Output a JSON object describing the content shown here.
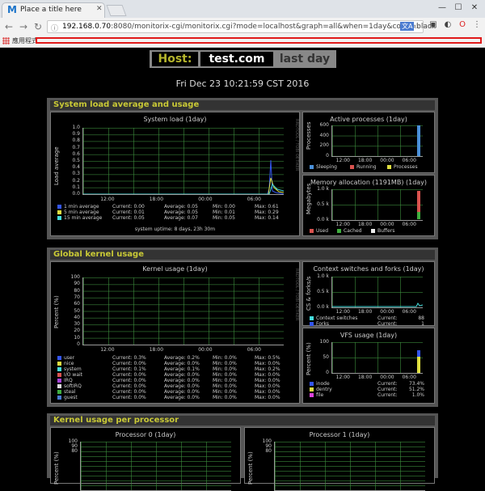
{
  "browser": {
    "tab_title": "Place a title here",
    "tab_favicon": "M",
    "url_prefix": "192.168.0.70",
    "url_rest": ":8080/monitorix-cgi/monitorix.cgi?mode=localhost&graph=all&when=1day&color=black",
    "translate_badge": "文A",
    "bookmarks_label": "應用程式",
    "window_controls": [
      "—",
      "☐",
      "✕"
    ]
  },
  "header": {
    "host_label": "Host:",
    "host_name": "test.com",
    "when_label": "last day",
    "date": "Fri Dec 23 10:21:59 CST 2016"
  },
  "colors": {
    "accent_title": "#c9c936",
    "sleeping": "#4a90d9",
    "running": "#d9534f",
    "processes": "#e0e040",
    "used": "#d9534f",
    "cached": "#3fae3f",
    "buffers": "#eeeeee"
  },
  "sections": {
    "system_load": {
      "title": "System load average and usage",
      "main": {
        "title": "System load  (1day)",
        "ylabel": "Load average",
        "side_label": "RRDTOOL / TOBI OETIKER",
        "yticks": [
          "1.0",
          "0.9",
          "0.8",
          "0.7",
          "0.6",
          "0.5",
          "0.4",
          "0.3",
          "0.2",
          "0.1",
          "0.0"
        ],
        "xticks": [
          "12:00",
          "18:00",
          "00:00",
          "06:00"
        ],
        "legend": [
          {
            "color": "#3355ee",
            "label": "1 min average",
            "current": "Current:  0.00",
            "average": "Average:  0.05",
            "min": "Min:   0.00",
            "max": "Max:  0.61"
          },
          {
            "color": "#e0e040",
            "label": "5 min average",
            "current": "Current:  0.01",
            "average": "Average:  0.05",
            "min": "Min:   0.01",
            "max": "Max:  0.29"
          },
          {
            "color": "#44dddd",
            "label": "15 min average",
            "current": "Current:  0.05",
            "average": "Average:  0.07",
            "min": "Min:   0.05",
            "max": "Max:  0.14"
          }
        ],
        "footer": "system uptime: 8 days, 23h 30m"
      },
      "processes": {
        "title": "Active processes  (1day)",
        "ylabel": "Processes",
        "yticks": [
          "600",
          "400",
          "200",
          "0"
        ],
        "xticks": [
          "12:00",
          "18:00",
          "00:00",
          "06:00"
        ],
        "legend": [
          {
            "color": "#4a90d9",
            "label": "Sleeping"
          },
          {
            "color": "#d9534f",
            "label": "Running"
          },
          {
            "color": "#e0e040",
            "label": "Processes"
          }
        ]
      },
      "memory": {
        "title": "Memory allocation (1191MB)  (1day)",
        "ylabel": "Megabytes",
        "yticks": [
          "1.0 k",
          "0.5 k",
          "0.0 k"
        ],
        "xticks": [
          "12:00",
          "18:00",
          "00:00",
          "06:00"
        ],
        "legend": [
          {
            "color": "#d9534f",
            "label": "Used"
          },
          {
            "color": "#3fae3f",
            "label": "Cached"
          },
          {
            "color": "#eeeeee",
            "label": "Buffers"
          }
        ]
      }
    },
    "kernel": {
      "title": "Global kernel usage",
      "main": {
        "title": "Kernel usage  (1day)",
        "ylabel": "Percent (%)",
        "side_label": "RRDTOOL / TOBI OETIKER",
        "yticks": [
          "100",
          "90",
          "80",
          "70",
          "60",
          "50",
          "40",
          "30",
          "20",
          "10",
          "0"
        ],
        "xticks": [
          "12:00",
          "18:00",
          "00:00",
          "06:00"
        ],
        "legend": [
          {
            "color": "#3355ee",
            "label": "user",
            "current": "Current:   0.3%",
            "average": "Average:   0.2%",
            "min": "Min:   0.0%",
            "max": "Max:   0.5%"
          },
          {
            "color": "#e0e040",
            "label": "nice",
            "current": "Current:   0.0%",
            "average": "Average:   0.0%",
            "min": "Min:   0.0%",
            "max": "Max:   0.0%"
          },
          {
            "color": "#44dddd",
            "label": "system",
            "current": "Current:   0.1%",
            "average": "Average:   0.1%",
            "min": "Min:   0.0%",
            "max": "Max:   0.2%"
          },
          {
            "color": "#d9534f",
            "label": "I/O wait",
            "current": "Current:   0.0%",
            "average": "Average:   0.0%",
            "min": "Min:   0.0%",
            "max": "Max:   0.0%"
          },
          {
            "color": "#aa44dd",
            "label": "IRQ",
            "current": "Current:   0.0%",
            "average": "Average:   0.0%",
            "min": "Min:   0.0%",
            "max": "Max:   0.0%"
          },
          {
            "color": "#dddddd",
            "label": "softIRQ",
            "current": "Current:   0.0%",
            "average": "Average:   0.0%",
            "min": "Min:   0.0%",
            "max": "Max:   0.0%"
          },
          {
            "color": "#3fae3f",
            "label": "steal",
            "current": "Current:   0.0%",
            "average": "Average:   0.0%",
            "min": "Min:   0.0%",
            "max": "Max:   0.0%"
          },
          {
            "color": "#4a7bd0",
            "label": "guest",
            "current": "Current:   0.0%",
            "average": "Average:   0.0%",
            "min": "Min:   0.0%",
            "max": "Max:   0.0%"
          }
        ]
      },
      "context": {
        "title": "Context switches and forks  (1day)",
        "ylabel": "CS & forks/s",
        "yticks": [
          "1.0 k",
          "0.5 k",
          "0.0 k"
        ],
        "xticks": [
          "12:00",
          "18:00",
          "00:00",
          "06:00"
        ],
        "legend": [
          {
            "color": "#44dddd",
            "label": "Context switches",
            "current": "Current:",
            "value": "88"
          },
          {
            "color": "#3355ee",
            "label": "Forks",
            "current": "Current:",
            "value": "1"
          }
        ]
      },
      "vfs": {
        "title": "VFS usage  (1day)",
        "ylabel": "Percent (%)",
        "yticks": [
          "100",
          "50",
          "0"
        ],
        "xticks": [
          "12:00",
          "18:00",
          "00:00",
          "06:00"
        ],
        "legend": [
          {
            "color": "#3355ee",
            "label": "inode",
            "current": "Current:",
            "value": "73.4%"
          },
          {
            "color": "#e0e040",
            "label": "dentry",
            "current": "Current:",
            "value": "51.2%"
          },
          {
            "color": "#dd44dd",
            "label": "file",
            "current": "Current:",
            "value": "1.0%"
          }
        ]
      }
    },
    "per_processor": {
      "title": "Kernel usage per processor",
      "cpu0": {
        "title": "Processor 0  (1day)",
        "ylabel": "Percent (%)",
        "yticks": [
          "100",
          "90",
          "80"
        ]
      },
      "cpu1": {
        "title": "Processor 1  (1day)",
        "ylabel": "Percent (%)",
        "yticks": [
          "100",
          "90",
          "80"
        ]
      }
    }
  }
}
